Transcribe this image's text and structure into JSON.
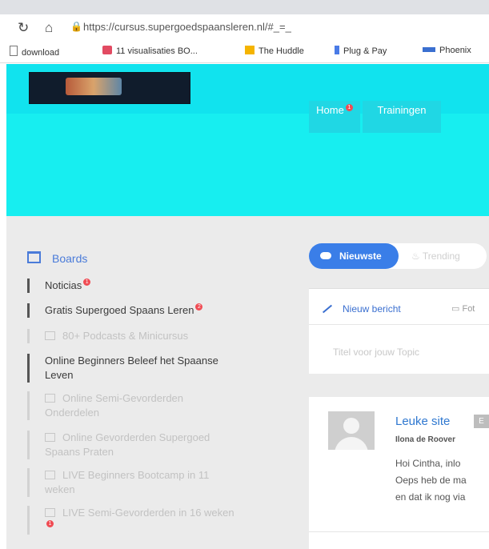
{
  "browser": {
    "url": "https://cursus.supergoedspaansleren.nl/#_=_",
    "bookmarks": [
      {
        "label": "download",
        "color": "#777777"
      },
      {
        "label": "11 visualisaties BO...",
        "color": "#e24b62"
      },
      {
        "label": "The Huddle",
        "color": "#f5b400"
      },
      {
        "label": "Plug & Pay",
        "color": "#4a7be6"
      },
      {
        "label": "Phoenix",
        "color": "#3a6fd0"
      }
    ]
  },
  "site": {
    "menu": [
      {
        "label": "Home",
        "badge": "1"
      },
      {
        "label": "Trainingen",
        "badge": ""
      }
    ]
  },
  "sidebar": {
    "heading": "Boards",
    "items": [
      {
        "label": "Noticias",
        "badge": "1",
        "locked": false
      },
      {
        "label": "Gratis Supergoed Spaans Leren",
        "badge": "2",
        "locked": false
      },
      {
        "label": "80+ Podcasts & Minicursus",
        "badge": "",
        "locked": true
      },
      {
        "label": "Online Beginners Beleef het Spaanse Leven",
        "badge": "",
        "locked": false
      },
      {
        "label": "Online Semi-Gevorderden Onderdelen",
        "badge": "",
        "locked": true
      },
      {
        "label": "Online Gevorderden Supergoed Spaans Praten",
        "badge": "",
        "locked": true
      },
      {
        "label": "LIVE Beginners Bootcamp in 11 weken",
        "badge": "",
        "locked": true
      },
      {
        "label": "LIVE Semi-Gevorderden in 16 weken",
        "badge": "1",
        "locked": true
      }
    ]
  },
  "feed": {
    "tabs": {
      "active": "Nieuwste",
      "other": "Trending"
    },
    "composer": {
      "new_post": "Nieuw bericht",
      "photo": "Fot",
      "title_placeholder": "Titel voor jouw Topic"
    },
    "post": {
      "title": "Leuke site",
      "tag": "E",
      "author": "Ilona de Roover",
      "lines": [
        "Hoi Cintha,  inlo",
        "Oeps heb de ma",
        "en dat ik nog via"
      ]
    }
  },
  "colors": {
    "accent": "#3a7ee8",
    "hero": "#17eef0",
    "badge": "#f04b53"
  }
}
